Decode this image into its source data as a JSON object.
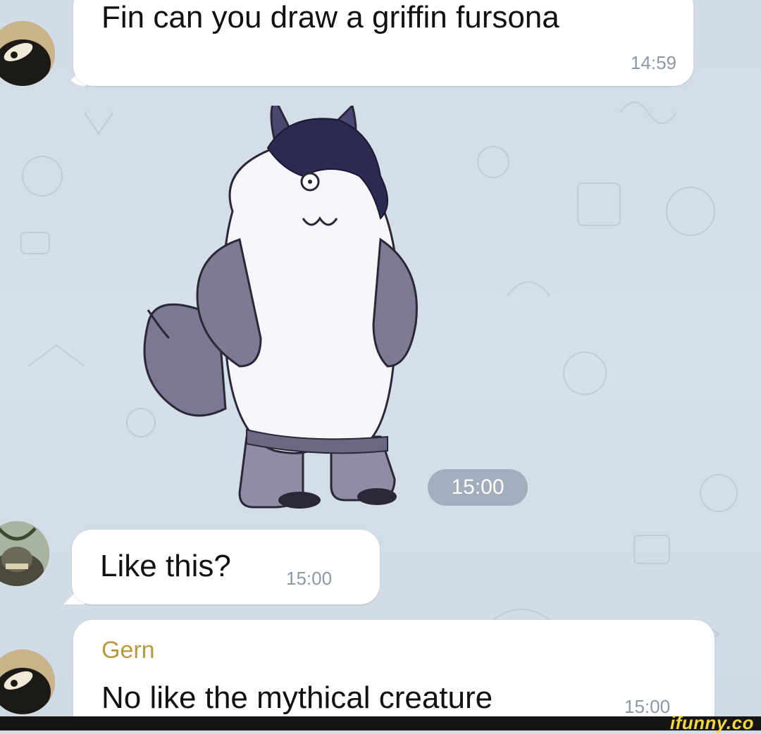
{
  "messages": [
    {
      "text": "Fin can you draw a griffin fursona",
      "time": "14:59"
    },
    {
      "sticker_time": "15:00"
    },
    {
      "text": "Like this?",
      "time": "15:00"
    },
    {
      "sender": "Gern",
      "text": "No like the mythical creature",
      "time": "15:00"
    }
  ],
  "watermark": "ifunny.co",
  "colors": {
    "bubble": "#ffffff",
    "sender": "#b89a3e",
    "time": "#8d98a3",
    "background": "#d3dde8"
  }
}
